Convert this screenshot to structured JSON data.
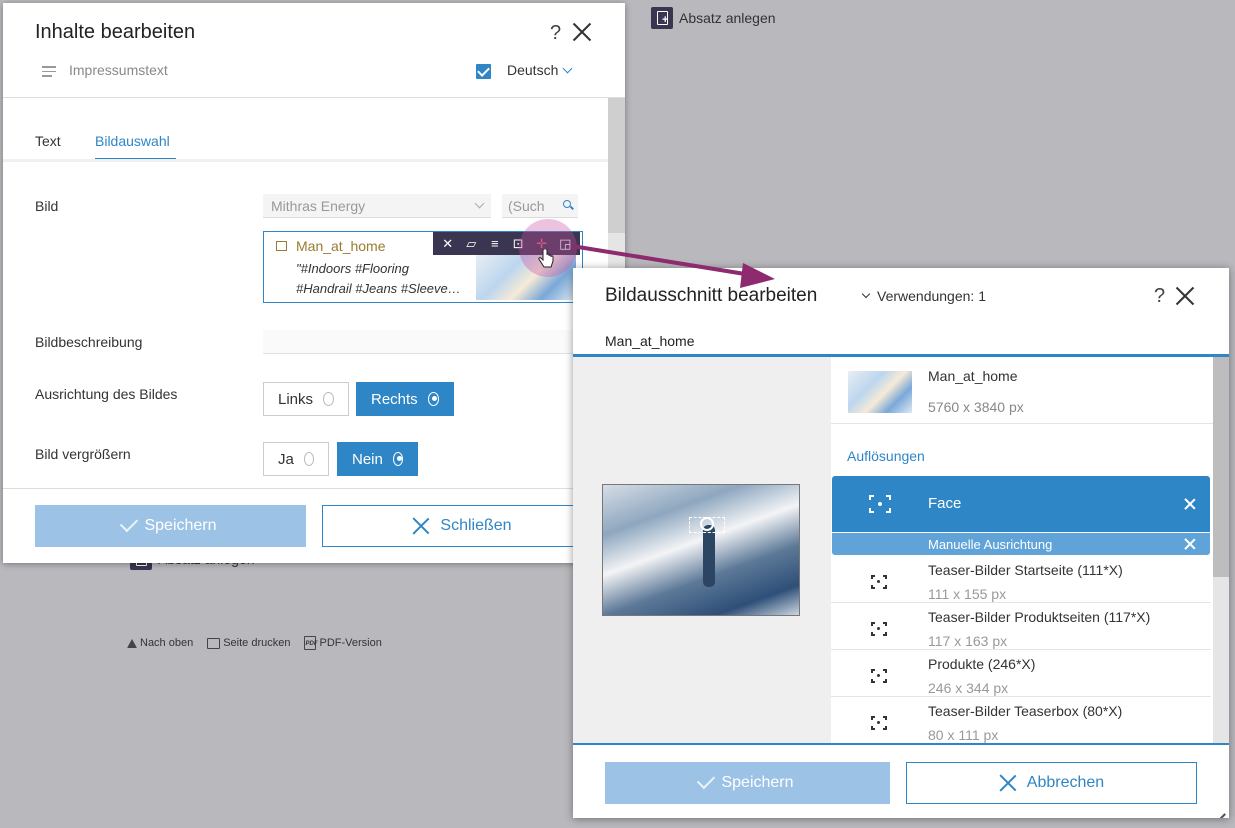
{
  "background": {
    "absatz_top": "Absatz anlegen",
    "absatz_bottom": "Absatz anlegen",
    "footer": {
      "nach_oben": "Nach oben",
      "seite_drucken": "Seite drucken",
      "pdf_version": "PDF-Version",
      "pdf_icon_text": "PDF"
    }
  },
  "edit_dialog": {
    "title": "Inhalte bearbeiten",
    "help": "?",
    "subtitle": "Impressumstext",
    "language": "Deutsch",
    "language_checked": true,
    "tabs": [
      {
        "label": "Text",
        "active": false
      },
      {
        "label": "Bildauswahl",
        "active": true
      }
    ],
    "fields": {
      "bild_label": "Bild",
      "source_select": "Mithras Energy",
      "search_placeholder": "(Such",
      "image_name": "Man_at_home",
      "image_tags_1": "\"#Indoors #Flooring",
      "image_tags_2": "#Handrail #Jeans #Sleeve…",
      "toolbar_icons": [
        "close-icon",
        "folder-open-icon",
        "edit-list-icon",
        "crop-icon",
        "focus-point-icon",
        "expand-icon"
      ],
      "beschreibung_label": "Bildbeschreibung",
      "beschreibung_value": "",
      "ausrichtung_label": "Ausrichtung des Bildes",
      "ausrichtung_options": [
        {
          "label": "Links",
          "selected": false
        },
        {
          "label": "Rechts",
          "selected": true
        }
      ],
      "vergroessern_label": "Bild vergrößern",
      "vergroessern_options": [
        {
          "label": "Ja",
          "selected": false
        },
        {
          "label": "Nein",
          "selected": true
        }
      ]
    },
    "save_label": "Speichern",
    "close_label": "Schließen"
  },
  "crop_dialog": {
    "title": "Bildausschnitt bearbeiten",
    "usage": "Verwendungen: 1",
    "help": "?",
    "image_name": "Man_at_home",
    "meta": {
      "name": "Man_at_home",
      "dimensions": "5760 x 3840 px"
    },
    "resolutions_heading": "Auflösungen",
    "active_resolution": {
      "label": "Face",
      "mode": "Manuelle Ausrichtung"
    },
    "resolutions": [
      {
        "name": "Teaser-Bilder Startseite (111*X)",
        "size": "111 x 155 px"
      },
      {
        "name": "Teaser-Bilder Produktseiten (117*X)",
        "size": "117 x 163 px"
      },
      {
        "name": "Produkte (246*X)",
        "size": "246 x 344 px"
      },
      {
        "name": "Teaser-Bilder Teaserbox (80*X)",
        "size": "80 x 111 px"
      }
    ],
    "save_label": "Speichern",
    "cancel_label": "Abbrechen"
  },
  "colors": {
    "accent": "#2f86c6",
    "accent_light": "#9cc3e5",
    "toolbar": "#3a3550",
    "annotation_arrow": "#8e2a6e",
    "asset_name": "#9a7b2f"
  }
}
